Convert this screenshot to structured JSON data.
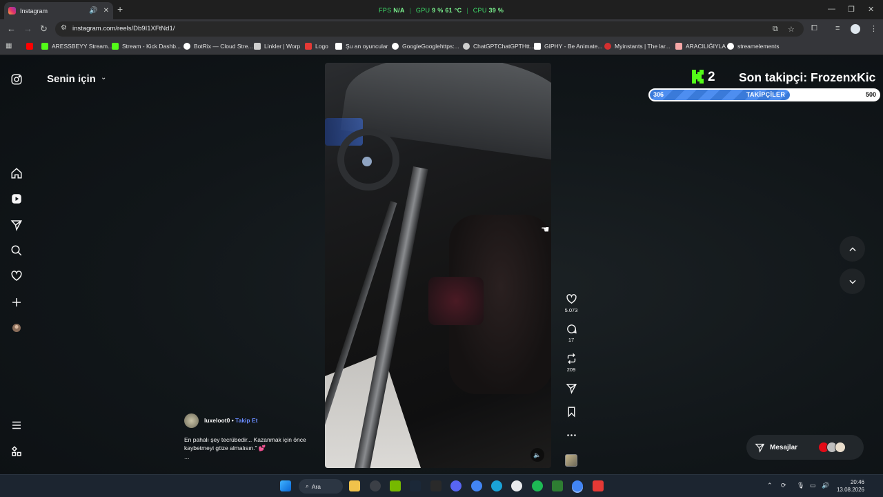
{
  "browser": {
    "tab_title": "Instagram",
    "url": "instagram.com/reels/Db9I1XFtNd1/",
    "perf": {
      "fps_label": "FPS",
      "fps_value": "N/A",
      "gpu_label": "GPU",
      "gpu_value": "9 %",
      "gpu_temp": "61 °C",
      "cpu_label": "CPU",
      "cpu_value": "39 %"
    },
    "bookmarks": [
      {
        "label": "ARESSBEYY Stream...",
        "color": "#53fc18"
      },
      {
        "label": "Stream - Kick Dashb...",
        "color": "#53fc18"
      },
      {
        "label": "BotRix — Cloud Stre...",
        "color": "#ffffff"
      },
      {
        "label": "Linkler | Worp",
        "color": "#cfcfcf"
      },
      {
        "label": "Logo",
        "color": "#e53935"
      },
      {
        "label": "Şu an oyuncular",
        "color": "#ffffff"
      },
      {
        "label": "GoogleGooglehttps:...",
        "color": "#ffffff"
      },
      {
        "label": "ChatGPTChatGPTHtt...",
        "color": "#cfcfcf"
      },
      {
        "label": "GIPHY - Be Animate...",
        "color": "#ffffff"
      },
      {
        "label": "Myinstants | The lar...",
        "color": "#d32f2f"
      },
      {
        "label": "ARACILIĞIYLA",
        "color": "#f4a6a6"
      },
      {
        "label": "streamelements",
        "color": "#ffffff"
      }
    ]
  },
  "instagram": {
    "feed_title": "Senin için",
    "post": {
      "username": "luxeloot0",
      "follow_label": "Takip Et",
      "caption": "En pahalı şey tecrübedir... Kazanmak için önce kaybetmeyi göze almalısın.\" 💕",
      "more": "...",
      "likes": "5.073",
      "comments": "17",
      "reposts": "209"
    },
    "messages_label": "Mesajlar"
  },
  "stream_overlay": {
    "kick_count": "2",
    "last_follower": "Son takipçi: FrozenxKic",
    "goal_start": "306",
    "goal_label": "TAKİPÇİLER",
    "goal_end": "500",
    "goal_current": 306,
    "goal_target": 500
  },
  "taskbar": {
    "search_label": "Ara",
    "time": "20:46",
    "date": "13.08.2026"
  },
  "colors": {
    "kick_green": "#53fc18",
    "ig_link_blue": "#6a8cff",
    "perf_green": "#3ee06a"
  }
}
